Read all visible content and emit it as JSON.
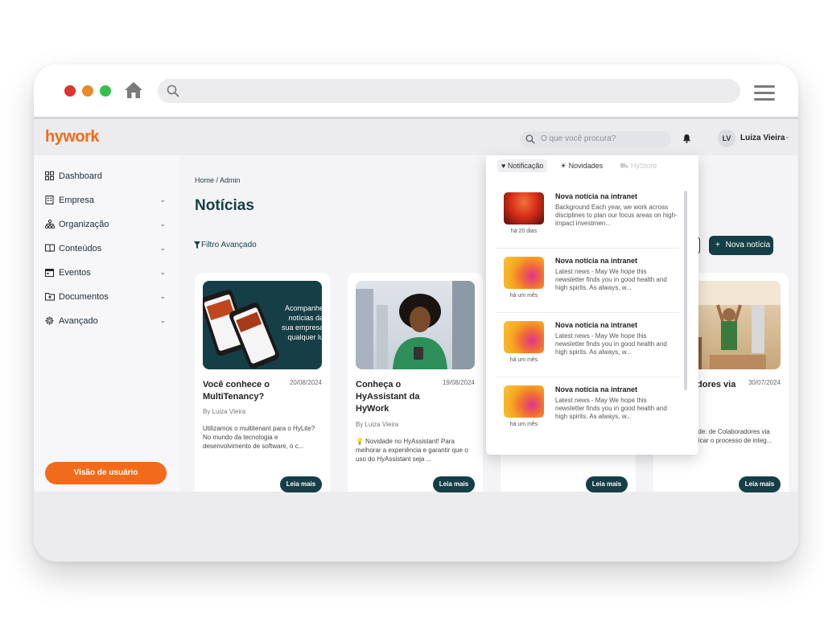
{
  "app": {
    "logo": "hywork"
  },
  "header": {
    "search_placeholder": "O que você procura?",
    "user_initials": "LV",
    "user_name": "Luiza Vieira"
  },
  "sidebar": {
    "items": [
      {
        "label": "Dashboard",
        "icon": "dashboard-icon",
        "expandable": false
      },
      {
        "label": "Empresa",
        "icon": "building-icon",
        "expandable": true
      },
      {
        "label": "Organização",
        "icon": "org-chart-icon",
        "expandable": true
      },
      {
        "label": "Conteúdos",
        "icon": "book-icon",
        "expandable": true
      },
      {
        "label": "Eventos",
        "icon": "calendar-icon",
        "expandable": true
      },
      {
        "label": "Documentos",
        "icon": "folder-icon",
        "expandable": true
      },
      {
        "label": "Avançado",
        "icon": "gear-icon",
        "expandable": true
      }
    ],
    "user_view_button": "Visão de usuário"
  },
  "main": {
    "breadcrumb": "Home / Admin",
    "title": "Notícias",
    "filter_label": "Filtro Avançado",
    "dropdown_label": "ia",
    "new_button": "Nova notícia"
  },
  "cards": [
    {
      "title": "Você conhece o MultiTenancy?",
      "date": "20/08/2024",
      "author": "By Luiza Vieira",
      "description": "Utilizamos o multitenant para o HyLite? No mundo da tecnologia e desenvolvimento de software, o c...",
      "image_text": "Acompanhe notícias da sua empresa qualquer lu",
      "more": "Leia mais"
    },
    {
      "title": "Conheça o HyAssistant da HyWork",
      "date": "19/08/2024",
      "author": "By Luiza Vieira",
      "description": "💡 Novidade no HyAssistant! Para melhorar a experiência e garantir que o uso do HyAssistant seja ...",
      "more": "Leia mais"
    },
    {
      "more": "Leia mais"
    },
    {
      "title": "ção de adores via",
      "date": "30/07/2024",
      "author": "",
      "description": "Funcionalidade: de Colaboradores via Excel Simplificar o processo de integ...",
      "more": "Leia mais"
    }
  ],
  "notifications": {
    "tabs": [
      {
        "label": "Notificação",
        "icon": "heart-icon",
        "state": "active"
      },
      {
        "label": "Novidades",
        "icon": "lightbulb-icon",
        "state": "normal"
      },
      {
        "label": "HyStore",
        "icon": "cart-icon",
        "state": "disabled"
      }
    ],
    "items": [
      {
        "title": "Nova notícia na intranet",
        "text": "Background Each year, we work across disciplines to plan our focus areas on high-impact investmen...",
        "time": "há 20 dias",
        "thumb": "red"
      },
      {
        "title": "Nova notícia na intranet",
        "text": "Latest news - May We hope this newsletter finds you in good health and high spirits. As always, w...",
        "time": "há um mês",
        "thumb": "shell"
      },
      {
        "title": "Nova notícia na intranet",
        "text": "Latest news - May We hope this newsletter finds you in good health and high spirits. As always, w...",
        "time": "há um mês",
        "thumb": "shell"
      },
      {
        "title": "Nova notícia na intranet",
        "text": "Latest news - May We hope this newsletter finds you in good health and high spirits. As always, w...",
        "time": "há um mês",
        "thumb": "shell"
      }
    ]
  },
  "colors": {
    "brand_orange": "#f26a1b",
    "primary_teal": "#163e46"
  }
}
